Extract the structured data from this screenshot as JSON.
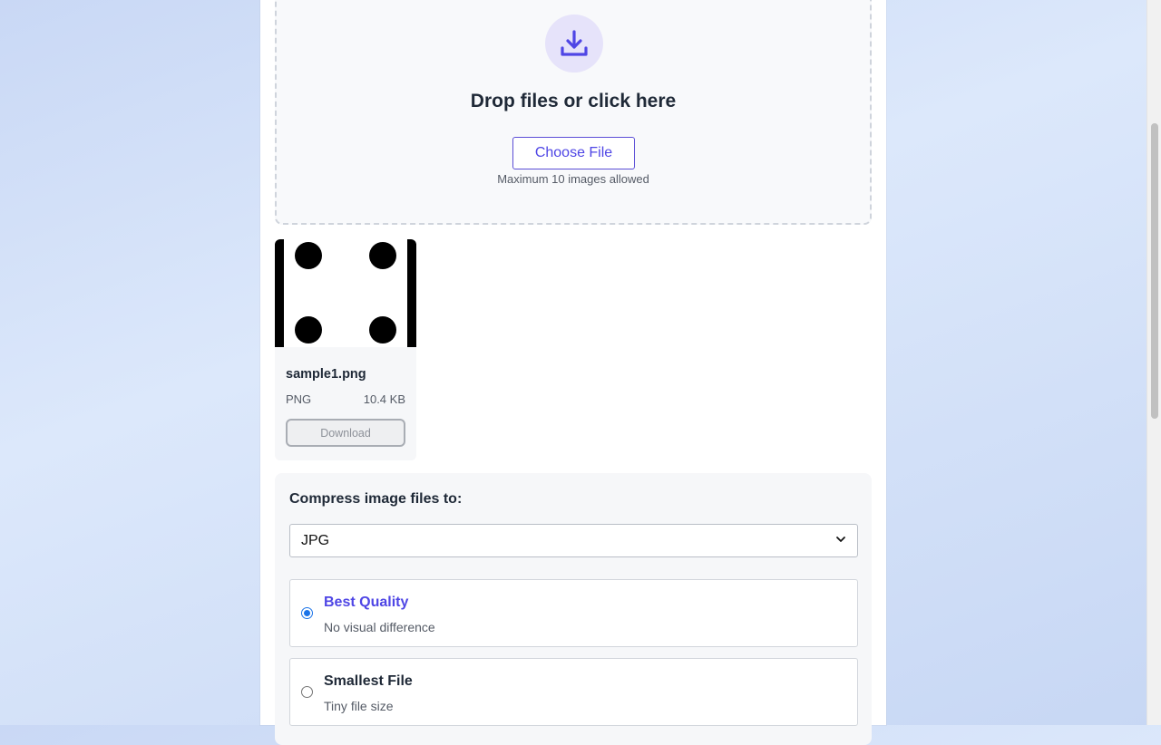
{
  "dropzone": {
    "title": "Drop files or click here",
    "choose_label": "Choose File",
    "note": "Maximum 10 images allowed",
    "icon": "download-icon"
  },
  "files": [
    {
      "name": "sample1.png",
      "type": "PNG",
      "size": "10.4 KB",
      "download_label": "Download"
    }
  ],
  "compress": {
    "label": "Compress image files to:",
    "selected_format": "JPG",
    "options": [
      {
        "title": "Best Quality",
        "desc": "No visual difference",
        "selected": true
      },
      {
        "title": "Smallest File",
        "desc": "Tiny file size",
        "selected": false
      }
    ]
  },
  "colors": {
    "accent": "#4f46e5",
    "icon_bg": "#e6e3fa"
  }
}
